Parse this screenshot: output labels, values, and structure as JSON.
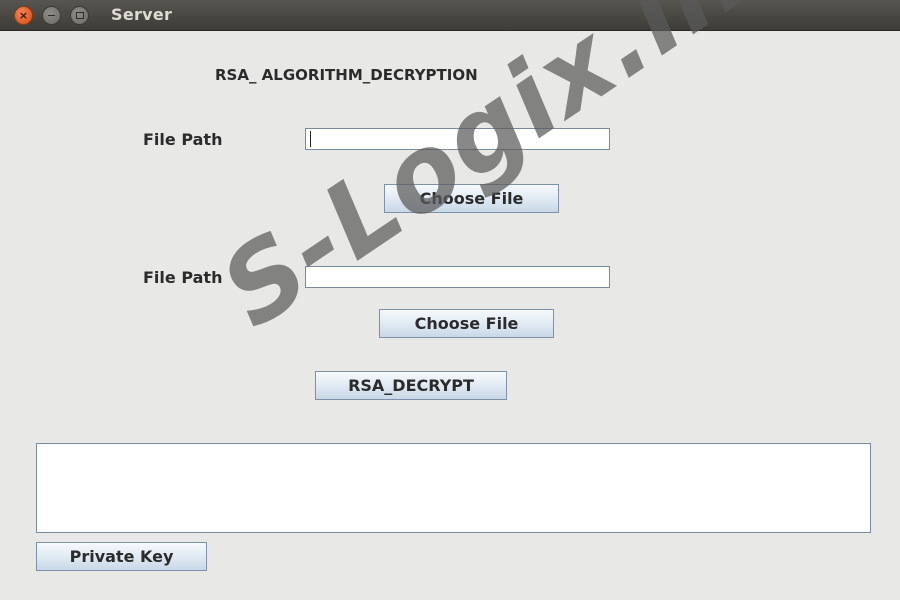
{
  "window": {
    "title": "Server",
    "close_glyph": "×",
    "close_icon": "close-icon",
    "minimize_icon": "minimize-icon",
    "maximize_icon": "maximize-icon"
  },
  "form": {
    "heading": "RSA_ ALGORITHM_DECRYPTION",
    "file_path_label_1": "File Path",
    "file_path_value_1": "",
    "choose_file_button_1": "Choose File",
    "file_path_label_2": "File Path",
    "file_path_value_2": "",
    "choose_file_button_2": "Choose File",
    "decrypt_button": "RSA_DECRYPT",
    "output_text": "",
    "private_key_button": "Private Key"
  },
  "watermark": {
    "text": "S-Logix.in"
  }
}
